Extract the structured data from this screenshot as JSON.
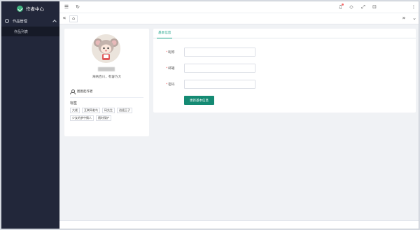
{
  "app": {
    "title": "作者中心",
    "brand_color": "#16a085"
  },
  "sidebar": {
    "group_label": "作品管理",
    "items": [
      {
        "label": "作品列表"
      }
    ]
  },
  "topbar": {
    "icons": [
      "menu-icon",
      "refresh-icon",
      "bell-icon",
      "tag-icon",
      "fullscreen-icon",
      "lock-icon",
      "more-vertical-icon"
    ]
  },
  "tabs": {
    "home_icon": "home-icon",
    "left_icon": "double-chevron-left-icon",
    "right_icon": "double-chevron-right-icon",
    "dropdown_icon": "chevron-down-icon"
  },
  "profile": {
    "bio": "海纳百川，有容乃大",
    "role": "圈图起作者",
    "tags_title": "标签",
    "tags": [
      "大佬",
      "互联网老鸟",
      "码先生",
      "逍遥王子",
      "少女的梦中情人",
      "随时保护"
    ]
  },
  "form": {
    "tab_label": "基本信息",
    "fields": [
      {
        "label": "昵称",
        "value": ""
      },
      {
        "label": "邮箱",
        "value": ""
      },
      {
        "label": "密码",
        "value": ""
      }
    ],
    "submit_label": "更新基本信息"
  }
}
